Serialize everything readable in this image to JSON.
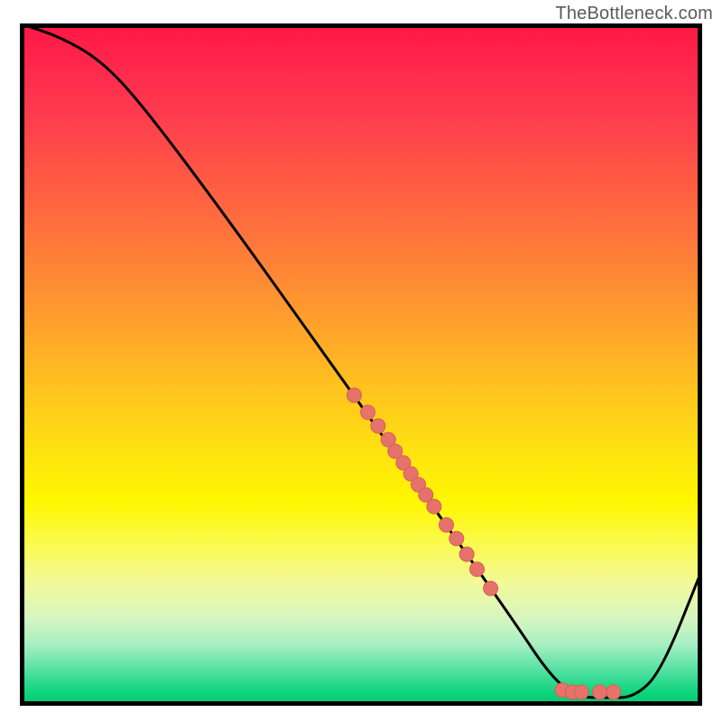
{
  "attribution": "TheBottleneck.com",
  "colors": {
    "curve": "#000000",
    "dot_fill": "#e5736b",
    "dot_stroke": "#d85f56"
  },
  "chart_data": {
    "type": "line",
    "title": "",
    "xlabel": "",
    "ylabel": "",
    "x_range": [
      0,
      100
    ],
    "y_range": [
      0,
      100
    ],
    "curve": [
      {
        "x": 0,
        "y": 100
      },
      {
        "x": 6,
        "y": 98
      },
      {
        "x": 12,
        "y": 94.5
      },
      {
        "x": 18,
        "y": 88
      },
      {
        "x": 30,
        "y": 72
      },
      {
        "x": 45,
        "y": 51
      },
      {
        "x": 60,
        "y": 30
      },
      {
        "x": 72,
        "y": 13
      },
      {
        "x": 78,
        "y": 4
      },
      {
        "x": 82,
        "y": 1.2
      },
      {
        "x": 86,
        "y": 1.2
      },
      {
        "x": 90,
        "y": 1.2
      },
      {
        "x": 94,
        "y": 5
      },
      {
        "x": 100,
        "y": 20
      }
    ],
    "dots": [
      {
        "x": 49,
        "y": 45.5
      },
      {
        "x": 51,
        "y": 43
      },
      {
        "x": 52.5,
        "y": 41
      },
      {
        "x": 54,
        "y": 39
      },
      {
        "x": 55,
        "y": 37.3
      },
      {
        "x": 56.2,
        "y": 35.6
      },
      {
        "x": 57.3,
        "y": 34
      },
      {
        "x": 58.4,
        "y": 32.4
      },
      {
        "x": 59.5,
        "y": 30.9
      },
      {
        "x": 60.7,
        "y": 29.2
      },
      {
        "x": 62.5,
        "y": 26.5
      },
      {
        "x": 64,
        "y": 24.5
      },
      {
        "x": 65.5,
        "y": 22.2
      },
      {
        "x": 67,
        "y": 20
      },
      {
        "x": 69,
        "y": 17.2
      },
      {
        "x": 79.5,
        "y": 2.3
      },
      {
        "x": 81,
        "y": 2.0
      },
      {
        "x": 82.3,
        "y": 2.0
      },
      {
        "x": 85,
        "y": 2.0
      },
      {
        "x": 87,
        "y": 2.0
      }
    ],
    "dot_radius_px": 8
  }
}
